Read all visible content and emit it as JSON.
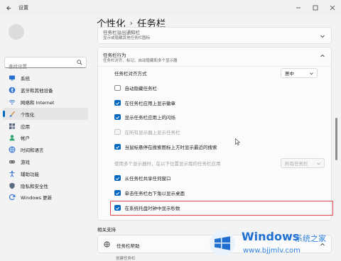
{
  "window": {
    "app_title": "设置"
  },
  "sidebar": {
    "search_placeholder": "查找设置",
    "items": [
      {
        "label": "系统",
        "icon": "monitor-icon",
        "color": "#2b6fcf"
      },
      {
        "label": "蓝牙和其他设备",
        "icon": "bluetooth-icon",
        "color": "#2b6fcf"
      },
      {
        "label": "网络和 Internet",
        "icon": "wifi-icon",
        "color": "#3c7fd6"
      },
      {
        "label": "个性化",
        "icon": "brush-icon",
        "color": "#d08a2f",
        "active": true
      },
      {
        "label": "应用",
        "icon": "apps-icon",
        "color": "#5a6a80"
      },
      {
        "label": "帐户",
        "icon": "account-icon",
        "color": "#2aa36b"
      },
      {
        "label": "时间和语言",
        "icon": "globe-icon",
        "color": "#2b6fcf"
      },
      {
        "label": "游戏",
        "icon": "gamepad-icon",
        "color": "#6b6b6b"
      },
      {
        "label": "辅助功能",
        "icon": "accessibility-icon",
        "color": "#2b6fcf"
      },
      {
        "label": "隐私和安全性",
        "icon": "shield-icon",
        "color": "#5a6a80"
      },
      {
        "label": "Windows 更新",
        "icon": "update-icon",
        "color": "#2b6fcf"
      }
    ]
  },
  "header": {
    "crumb_parent": "个性化",
    "separator": "›",
    "crumb_current": "任务栏"
  },
  "top_card": {
    "title": "任务栏溢出通知栏",
    "subtitle": "显示或隐藏其他任务栏图标"
  },
  "behaviors": {
    "title": "任务栏行为",
    "subtitle": "任务栏对齐、标记、自动隐藏和多个显示器",
    "alignment": {
      "label": "任务栏对齐方式",
      "value": "居中"
    },
    "options": [
      {
        "label": "自动隐藏任务栏",
        "checked": false,
        "disabled": false
      },
      {
        "label": "在任务栏应用上显示徽章",
        "checked": true,
        "disabled": false
      },
      {
        "label": "显示任务栏应用上的闪烁",
        "checked": true,
        "disabled": false
      },
      {
        "label": "在所有显示器上显示任务栏",
        "checked": false,
        "disabled": true
      },
      {
        "label": "当鼠标悬停在搜索图标上方时显示最近的搜索",
        "checked": true,
        "disabled": false
      },
      {
        "label": "使用多个显示器时，在以下位置显示我的任务栏应用",
        "checked": false,
        "disabled": true,
        "row": true
      },
      {
        "label": "从任务栏共享任何窗口",
        "checked": true,
        "disabled": false
      },
      {
        "label": "单击任务栏右下角以显示桌面",
        "checked": true,
        "disabled": false
      },
      {
        "label": "在系统托盘时钟中显示秒数",
        "checked": true,
        "disabled": false,
        "highlighted": true
      }
    ],
    "multi_display_value": "所有任务栏"
  },
  "related": {
    "heading": "相关支持",
    "help_label": "任务栏帮助",
    "help_sub": "创建任务栏"
  },
  "watermark": {
    "brand": "Windows",
    "cn": "系统之家",
    "url": "www.bjjmlv.com"
  },
  "colors": {
    "accent": "#0067c0",
    "highlight": "#e0414b"
  }
}
